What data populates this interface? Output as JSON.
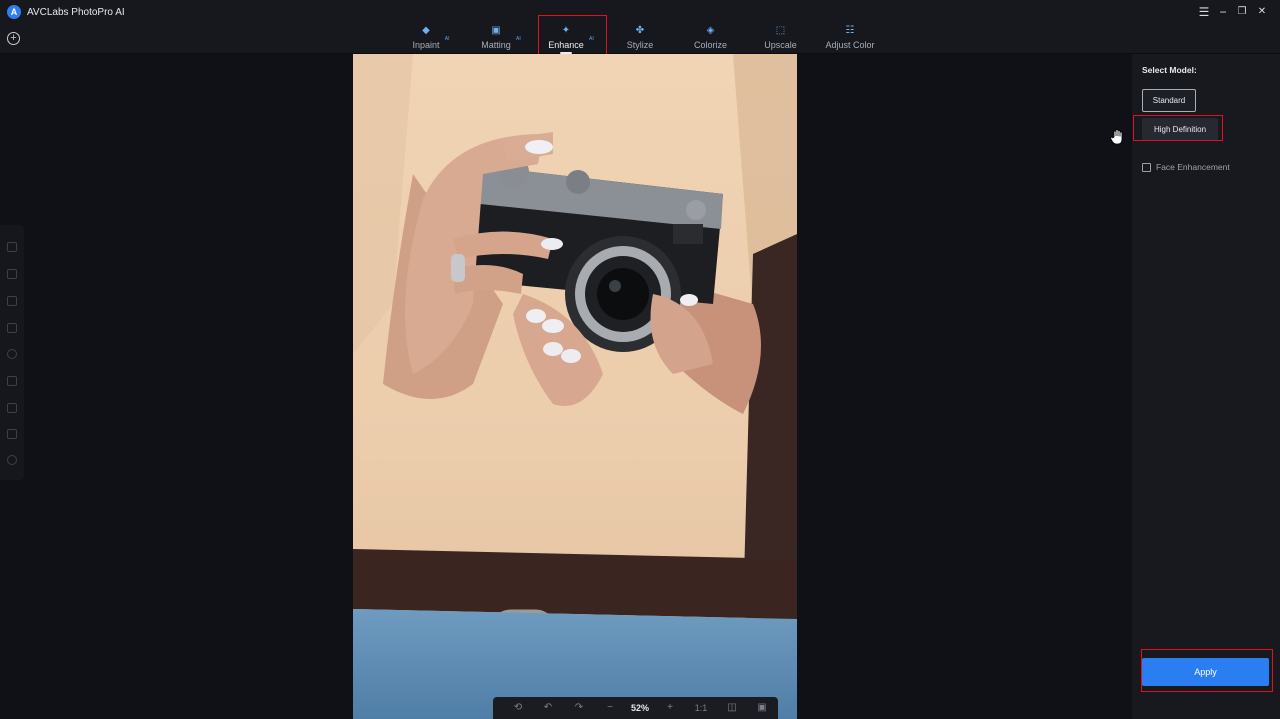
{
  "app": {
    "title": "AVCLabs PhotoPro AI",
    "logo_letter": "A"
  },
  "window_controls": {
    "menu": "☰",
    "minimize": "−",
    "restore": "❐",
    "close": "✕"
  },
  "toolbar": {
    "add": "+"
  },
  "tabs": [
    {
      "label": "Inpaint",
      "badge": "AI",
      "icon": "inpaint-icon"
    },
    {
      "label": "Matting",
      "badge": "AI",
      "icon": "matting-icon"
    },
    {
      "label": "Enhance",
      "badge": "AI",
      "icon": "enhance-icon",
      "active": true
    },
    {
      "label": "Stylize",
      "badge": "",
      "icon": "stylize-icon"
    },
    {
      "label": "Colorize",
      "badge": "",
      "icon": "colorize-icon"
    },
    {
      "label": "Upscale",
      "badge": "",
      "icon": "upscale-icon"
    },
    {
      "label": "Adjust Color",
      "badge": "",
      "icon": "adjust-color-icon"
    }
  ],
  "zoom_bar": {
    "zoom": "52%",
    "minus": "−",
    "plus": "+",
    "ratio": "1:1"
  },
  "right_panel": {
    "select_model_label": "Select Model:",
    "models": [
      "Standard",
      "High Definition"
    ],
    "selected_model": "High Definition",
    "face_enhancement_label": "Face Enhancement",
    "face_enhancement_checked": false,
    "apply_label": "Apply"
  },
  "colors": {
    "accent": "#2a7ef2",
    "highlight": "#e0121b",
    "photo_background": "#ead2b3"
  }
}
